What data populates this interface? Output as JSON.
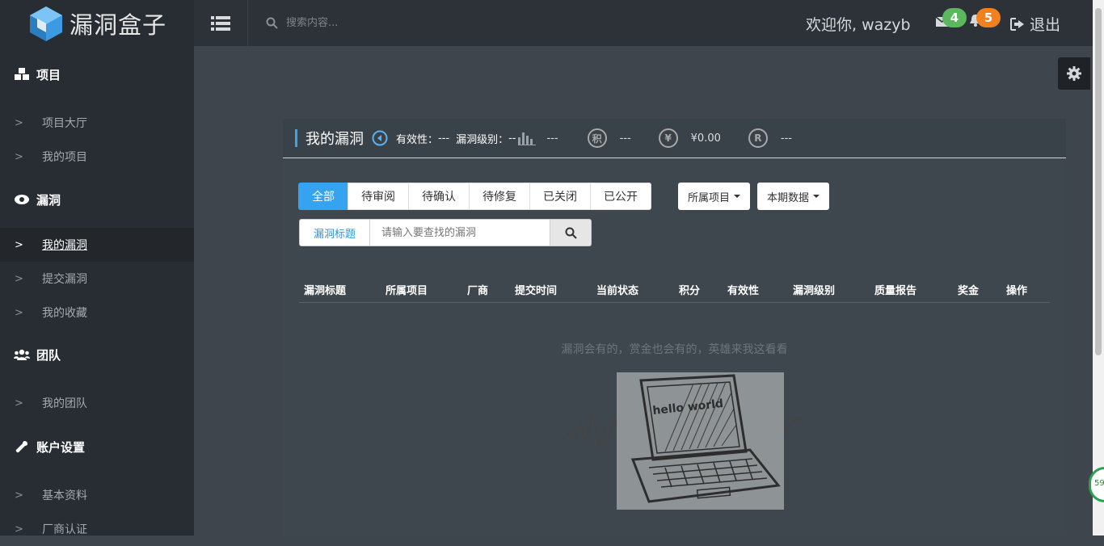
{
  "app": {
    "logo_text": "漏洞盒子"
  },
  "sidebar": {
    "sections": [
      {
        "title": "项目",
        "icon": "cubes-icon",
        "items": [
          {
            "label": "项目大厅"
          },
          {
            "label": "我的项目"
          }
        ]
      },
      {
        "title": "漏洞",
        "icon": "eye-icon",
        "items": [
          {
            "label": "我的漏洞",
            "active": true
          },
          {
            "label": "提交漏洞"
          },
          {
            "label": "我的收藏"
          }
        ]
      },
      {
        "title": "团队",
        "icon": "users-icon",
        "items": [
          {
            "label": "我的团队"
          }
        ]
      },
      {
        "title": "账户设置",
        "icon": "wrench-icon",
        "items": [
          {
            "label": "基本资料"
          },
          {
            "label": "厂商认证"
          }
        ]
      }
    ]
  },
  "topbar": {
    "search_placeholder": "搜索内容...",
    "welcome": "欢迎你, wazyb",
    "mail_count": "4",
    "notify_count": "5",
    "logout_label": "退出"
  },
  "panel": {
    "title": "我的漏洞",
    "validity_label": "有效性：",
    "validity_value": "---",
    "level_label": "漏洞级别：",
    "level_value": "--",
    "stat1_value": "---",
    "points_coin": "积",
    "points_value": "---",
    "money_coin": "¥",
    "money_value": "¥0.00",
    "r_coin": "R",
    "r_value": "---"
  },
  "tabs": [
    {
      "label": "全部",
      "active": true
    },
    {
      "label": "待审阅"
    },
    {
      "label": "待确认"
    },
    {
      "label": "待修复"
    },
    {
      "label": "已关闭"
    },
    {
      "label": "已公开"
    }
  ],
  "filters": {
    "project_label": "所属项目",
    "period_label": "本期数据"
  },
  "vuln_search": {
    "label": "漏洞标题",
    "placeholder": "请输入要查找的漏洞"
  },
  "table": {
    "headers": [
      "漏洞标题",
      "所属项目",
      "厂商",
      "提交时间",
      "当前状态",
      "积分",
      "有效性",
      "漏洞级别",
      "质量报告",
      "奖金",
      "操作"
    ]
  },
  "empty": {
    "message": "漏洞会有的，赏金也会有的，英雄来我这看看",
    "laptop_text": "hello world"
  },
  "floating": {
    "bubble_text": "59"
  },
  "colors": {
    "accent": "#35a3ef",
    "sidebar_bg": "#282d33",
    "badge_green": "#5cb85c",
    "badge_orange": "#f0811e"
  }
}
